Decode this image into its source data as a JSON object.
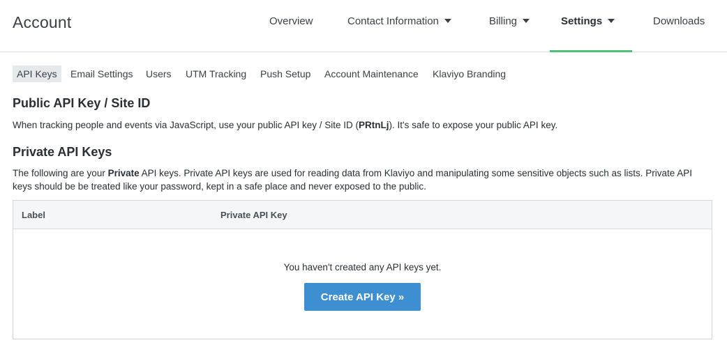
{
  "header": {
    "title": "Account",
    "nav": [
      {
        "label": "Overview",
        "has_caret": false
      },
      {
        "label": "Contact Information",
        "has_caret": true
      },
      {
        "label": "Billing",
        "has_caret": true
      },
      {
        "label": "Settings",
        "has_caret": true,
        "active": true
      },
      {
        "label": "Downloads",
        "has_caret": false
      }
    ],
    "active_color": "#4fbf73"
  },
  "subnav": [
    {
      "label": "API Keys",
      "active": true
    },
    {
      "label": "Email Settings"
    },
    {
      "label": "Users"
    },
    {
      "label": "UTM Tracking"
    },
    {
      "label": "Push Setup"
    },
    {
      "label": "Account Maintenance"
    },
    {
      "label": "Klaviyo Branding"
    }
  ],
  "public_section": {
    "title": "Public API Key / Site ID",
    "text_before": "When tracking people and events via JavaScript, use your public API key / Site ID (",
    "site_id": "PRtnLj",
    "text_after": "). It's safe to expose your public API key."
  },
  "private_section": {
    "title": "Private API Keys",
    "text_before": "The following are your ",
    "emphasis": "Private",
    "text_after": " API keys. Private API keys are used for reading data from Klaviyo and manipulating some sensitive objects such as lists. Private API keys should be be treated like your password, kept in a safe place and never exposed to the public."
  },
  "table": {
    "columns": [
      "Label",
      "Private API Key"
    ],
    "empty_message": "You haven't created any API keys yet.",
    "create_button": "Create API Key »",
    "button_color": "#3d8fd2"
  }
}
